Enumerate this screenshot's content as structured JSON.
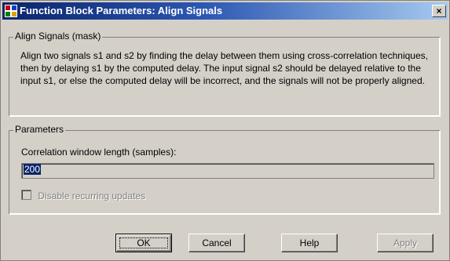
{
  "window": {
    "title": "Function Block Parameters: Align Signals",
    "close_glyph": "×"
  },
  "mask_group": {
    "legend": "Align Signals (mask)",
    "description": "Align two signals s1 and s2 by finding the delay between them using cross-correlation techniques, then by delaying s1 by the computed delay.  The input signal s2 should be delayed relative to the input s1, or else the computed delay will be incorrect, and the signals will not be properly aligned."
  },
  "parameters_group": {
    "legend": "Parameters",
    "correlation_label": "Correlation window length (samples):",
    "correlation_value": "200",
    "checkbox_label": "Disable recurring updates",
    "checkbox_checked": false,
    "checkbox_disabled": true
  },
  "buttons": {
    "ok": "OK",
    "cancel": "Cancel",
    "help": "Help",
    "apply": "Apply"
  },
  "icons": {
    "title_icon": "simulink-block-icon",
    "close_icon": "close-icon"
  }
}
